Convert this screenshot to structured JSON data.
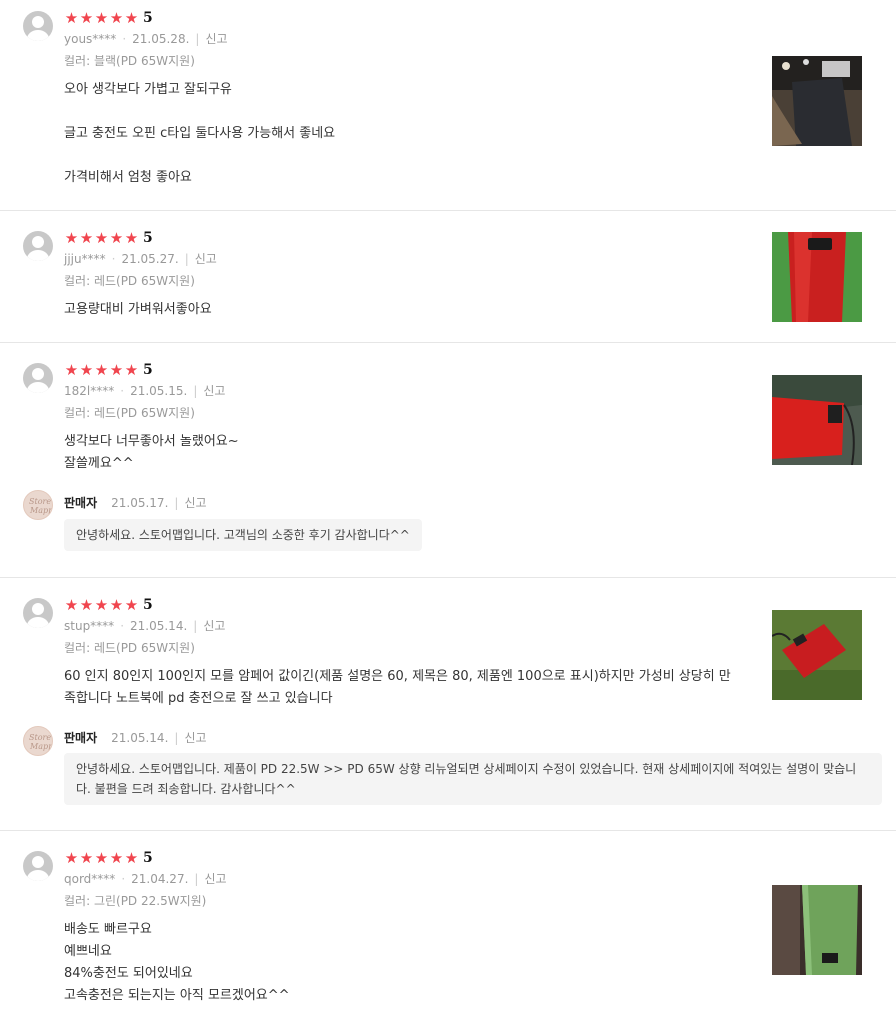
{
  "reviews": [
    {
      "rating": "5",
      "user": "yous****",
      "date": "21.05.28.",
      "report": "신고",
      "option": "컬러: 블랙(PD 65W지원)",
      "lines": [
        "오아 생각보다 가볍고 잘되구유",
        "글고 충전도 오핀 c타입 둘다사용 가능해서 좋네요",
        "가격비해서 엄청 좋아요"
      ]
    },
    {
      "rating": "5",
      "user": "jjju****",
      "date": "21.05.27.",
      "report": "신고",
      "option": "컬러: 레드(PD 65W지원)",
      "lines": [
        "고용량대비 가벼워서좋아요"
      ]
    },
    {
      "rating": "5",
      "user": "182l****",
      "date": "21.05.15.",
      "report": "신고",
      "option": "컬러: 레드(PD 65W지원)",
      "lines": [
        "생각보다 너무좋아서 놀랬어요~",
        "잘쓸께요^^"
      ],
      "seller": {
        "name": "판매자",
        "date": "21.05.17.",
        "report": "신고",
        "reply": "안녕하세요. 스토어맵입니다. 고객님의 소중한 후기 감사합니다^^"
      }
    },
    {
      "rating": "5",
      "user": "stup****",
      "date": "21.05.14.",
      "report": "신고",
      "option": "컬러: 레드(PD 65W지원)",
      "lines": [
        "60 인지 80인지 100인지 모를 암페어 값이긴(제품 설명은 60, 제목은 80, 제품엔 100으로 표시)하지만 가성비 상당히 만족합니다 노트북에 pd 충전으로 잘 쓰고 있습니다"
      ],
      "seller": {
        "name": "판매자",
        "date": "21.05.14.",
        "report": "신고",
        "reply": "안녕하세요. 스토어맵입니다. 제품이 PD 22.5W >> PD 65W 상향 리뉴얼되면 상세페이지 수정이 있었습니다. 현재 상세페이지에 적여있는 설명이 맞습니다. 불편을 드려 죄송합니다. 감사합니다^^"
      }
    },
    {
      "rating": "5",
      "user": "qord****",
      "date": "21.04.27.",
      "report": "신고",
      "option": "컬러: 그린(PD 22.5W지원)",
      "lines": [
        "배송도 빠르구요",
        "예쁘네요",
        "84%충전도 되어있네요",
        "고속충전은 되는지는 아직 모르겠어요^^"
      ]
    }
  ],
  "seller_logo": [
    "Store",
    "Mapp"
  ],
  "colors": {
    "star": "#f0454e",
    "black_product": "#2a2c31",
    "red_product": "#d32b2b",
    "green_product": "#6fa35b"
  }
}
